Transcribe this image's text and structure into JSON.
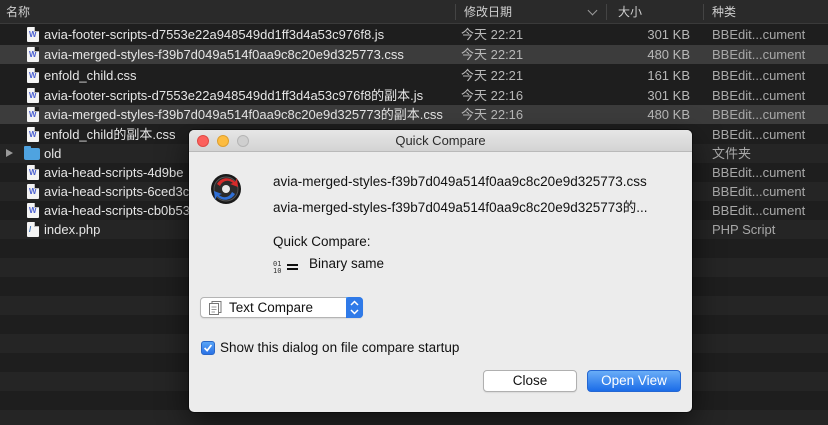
{
  "finder": {
    "columns": {
      "name": "名称",
      "date": "修改日期",
      "size": "大小",
      "kind": "种类"
    },
    "rows": [
      {
        "name": "avia-footer-scripts-d7553e22a948549dd1ff3d4a53c976f8.js",
        "date": "今天 22:21",
        "size": "301 KB",
        "kind": "BBEdit...cument",
        "icon": "js-file-icon"
      },
      {
        "name": "avia-merged-styles-f39b7d049a514f0aa9c8c20e9d325773.css",
        "date": "今天 22:21",
        "size": "480 KB",
        "kind": "BBEdit...cument",
        "icon": "css-file-icon"
      },
      {
        "name": "enfold_child.css",
        "date": "今天 22:21",
        "size": "161 KB",
        "kind": "BBEdit...cument",
        "icon": "css-file-icon"
      },
      {
        "name": "avia-footer-scripts-d7553e22a948549dd1ff3d4a53c976f8的副本.js",
        "date": "今天 22:16",
        "size": "301 KB",
        "kind": "BBEdit...cument",
        "icon": "js-file-icon"
      },
      {
        "name": "avia-merged-styles-f39b7d049a514f0aa9c8c20e9d325773的副本.css",
        "date": "今天 22:16",
        "size": "480 KB",
        "kind": "BBEdit...cument",
        "icon": "css-file-icon"
      },
      {
        "name": "enfold_child的副本.css",
        "date": "",
        "size": "",
        "kind": "BBEdit...cument",
        "icon": "css-file-icon"
      },
      {
        "name": "old",
        "date": "",
        "size": "",
        "kind": "文件夹",
        "icon": "folder-icon"
      },
      {
        "name": "avia-head-scripts-4d9be",
        "date": "",
        "size": "",
        "kind": "BBEdit...cument",
        "icon": "js-file-icon"
      },
      {
        "name": "avia-head-scripts-6ced3c",
        "date": "",
        "size": "",
        "kind": "BBEdit...cument",
        "icon": "js-file-icon"
      },
      {
        "name": "avia-head-scripts-cb0b53",
        "date": "",
        "size": "",
        "kind": "BBEdit...cument",
        "icon": "js-file-icon"
      },
      {
        "name": "index.php",
        "date": "",
        "size": "",
        "kind": "PHP Script",
        "icon": "php-file-icon"
      }
    ]
  },
  "dialog": {
    "title": "Quick Compare",
    "file1": "avia-merged-styles-f39b7d049a514f0aa9c8c20e9d325773.css",
    "file2": "avia-merged-styles-f39b7d049a514f0aa9c8c20e9d325773的...",
    "compare_label": "Quick Compare:",
    "result": "Binary same",
    "popup_value": "Text Compare",
    "checkbox_label": "Show this dialog on file compare startup",
    "checkbox_checked": true,
    "close_label": "Close",
    "open_label": "Open View",
    "accent": "#2a72e6"
  }
}
